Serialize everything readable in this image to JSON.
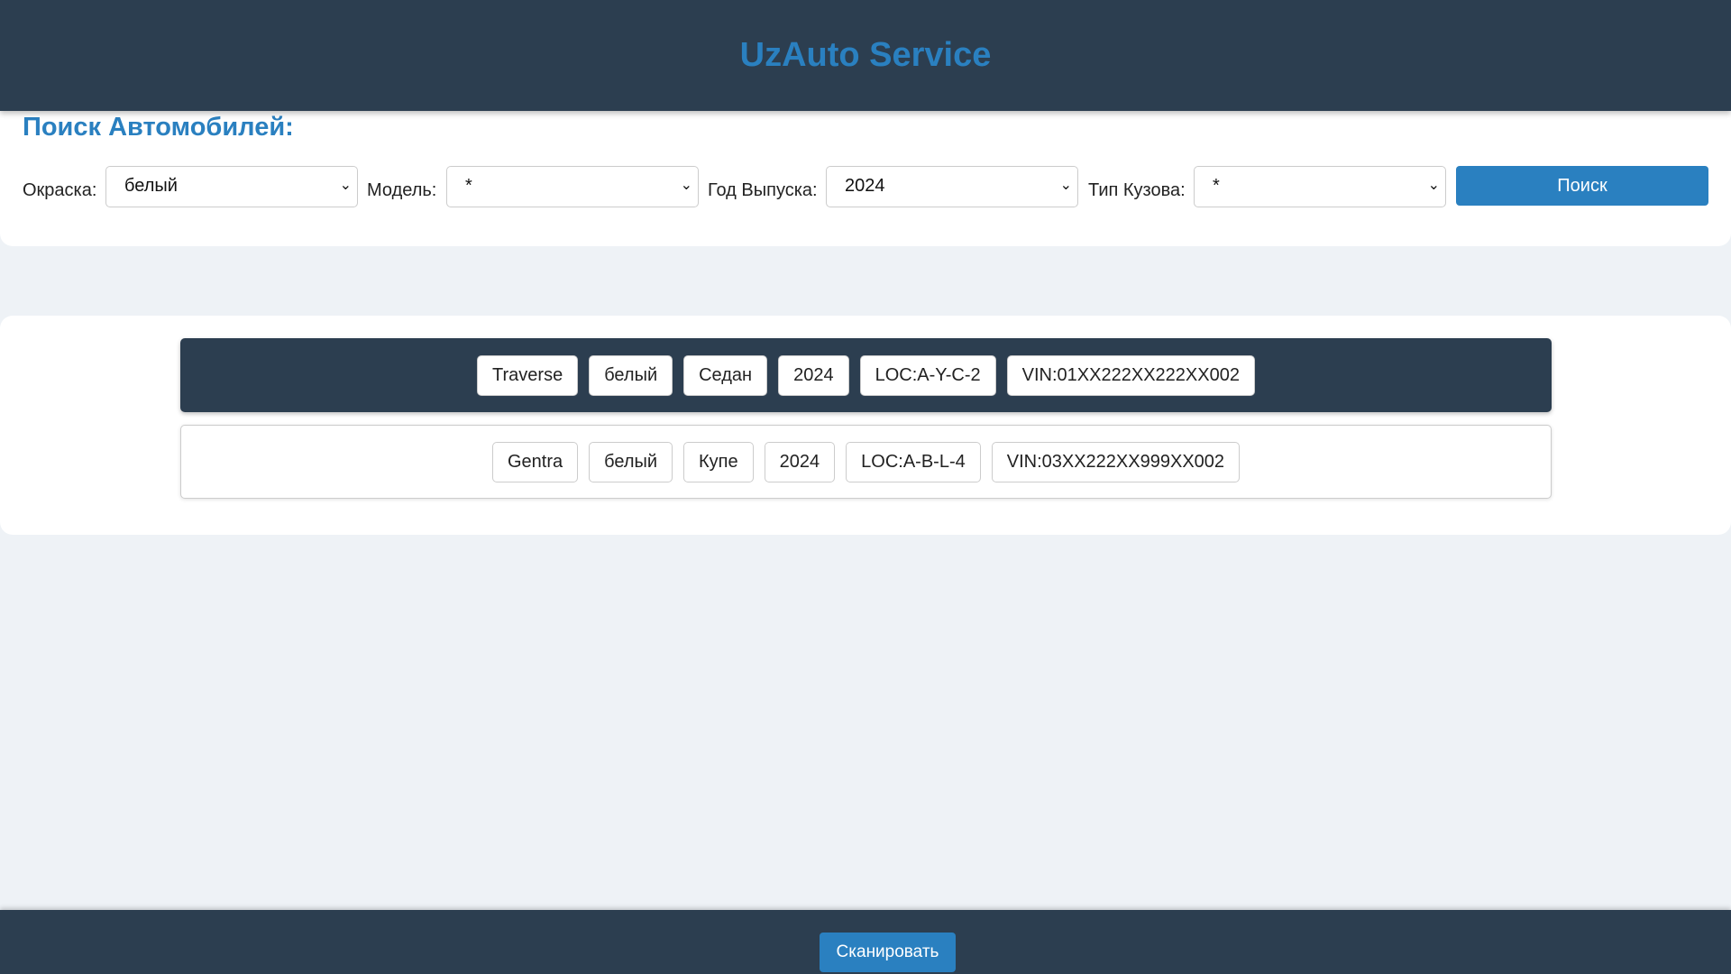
{
  "header": {
    "title": "UzAuto Service"
  },
  "search": {
    "heading": "Поиск Автомобилей:",
    "fields": [
      {
        "label": "Окраска:",
        "value": "белый"
      },
      {
        "label": "Модель:",
        "value": "*"
      },
      {
        "label": "Год Выпуска:",
        "value": "2024"
      },
      {
        "label": "Тип Кузова:",
        "value": "*"
      }
    ],
    "button": "Поиск"
  },
  "results": [
    {
      "selected": true,
      "chips": [
        "Traverse",
        "белый",
        "Седан",
        "2024",
        "LOC:A-Y-C-2",
        "VIN:01XX222XX222XX002"
      ]
    },
    {
      "selected": false,
      "chips": [
        "Gentra",
        "белый",
        "Купе",
        "2024",
        "LOC:A-B-L-4",
        "VIN:03XX222XX999XX002"
      ]
    }
  ],
  "footer": {
    "scan_button": "Сканировать"
  },
  "colors": {
    "header": "#2c3e50",
    "accent": "#2a80c0",
    "background": "#eef2f6"
  }
}
